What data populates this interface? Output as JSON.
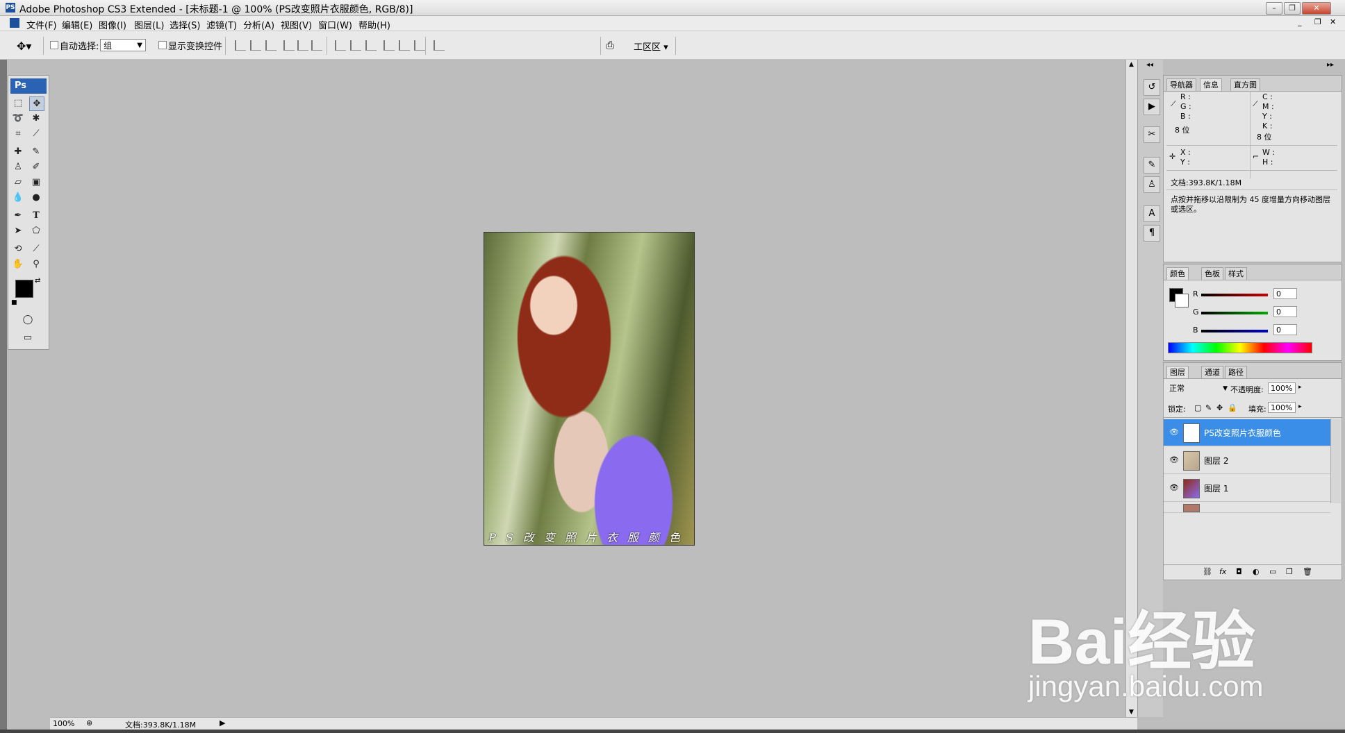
{
  "window": {
    "title": "Adobe Photoshop CS3 Extended - [未标题-1 @ 100% (PS改变照片衣服颜色, RGB/8)]",
    "logo": "PS"
  },
  "menu": [
    "文件(F)",
    "编辑(E)",
    "图像(I)",
    "图层(L)",
    "选择(S)",
    "滤镜(T)",
    "分析(A)",
    "视图(V)",
    "窗口(W)",
    "帮助(H)"
  ],
  "options": {
    "auto_select_label": "自动选择:",
    "auto_select_value": "组",
    "show_transform_label": "显示变换控件",
    "workspace_label": "工区区 ▾"
  },
  "toolbox": {
    "header": "Ps"
  },
  "canvas": {
    "caption": "PS改变照片衣服颜色"
  },
  "status": {
    "zoom": "100%",
    "doc": "文档:393.8K/1.18M"
  },
  "info_panel": {
    "tabs": [
      "导航器",
      "信息",
      "直方图"
    ],
    "rgb": [
      "R :",
      "G :",
      "B :"
    ],
    "cmyk": [
      "C :",
      "M :",
      "Y :",
      "K :"
    ],
    "bits_left": "8 位",
    "bits_right": "8 位",
    "xy": [
      "X :",
      "Y :"
    ],
    "wh": [
      "W :",
      "H :"
    ],
    "doc": "文档:393.8K/1.18M",
    "hint": "点按并拖移以沿限制为 45 度增量方向移动图层或选区。"
  },
  "color_panel": {
    "tabs": [
      "颜色",
      "色板",
      "样式"
    ],
    "channels": [
      {
        "label": "R",
        "value": "0"
      },
      {
        "label": "G",
        "value": "0"
      },
      {
        "label": "B",
        "value": "0"
      }
    ],
    "colors": {
      "r": "#cc0000",
      "g": "#00aa00",
      "b": "#0000cc"
    }
  },
  "layers_panel": {
    "tabs": [
      "图层",
      "通道",
      "路径"
    ],
    "blend_mode": "正常",
    "opacity_label": "不透明度:",
    "opacity": "100%",
    "lock_label": "锁定:",
    "fill_label": "填充:",
    "fill": "100%",
    "layers": [
      {
        "name": "PS改变照片衣服颜色",
        "thumb": "T"
      },
      {
        "name": "图层 2",
        "thumb": ""
      },
      {
        "name": "图层 1",
        "thumb": ""
      }
    ]
  },
  "watermark": {
    "brand": "Bai经验",
    "url": "jingyan.baidu.com"
  }
}
